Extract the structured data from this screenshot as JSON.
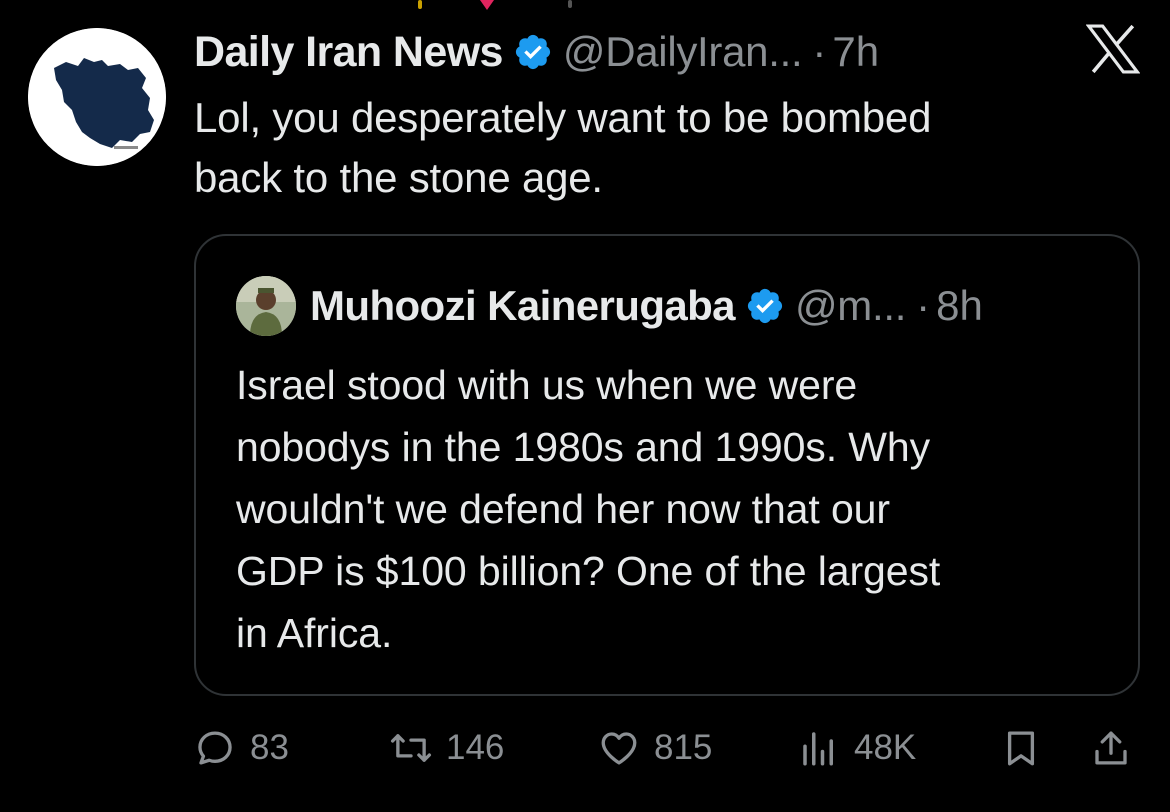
{
  "tweet": {
    "author_name": "Daily Iran News",
    "handle": "@DailyIran...",
    "separator": "·",
    "time": "7h",
    "text_line1": "Lol, you desperately want to be bombed",
    "text_line2": "back to the stone age."
  },
  "quoted_tweet": {
    "author_name": "Muhoozi Kainerugaba",
    "handle": "@m...",
    "separator": "·",
    "time": "8h",
    "lines": [
      "Israel stood with us when we were",
      "nobodys in the 1980s and 1990s. Why",
      "wouldn't we defend her now that our",
      "GDP is $100 billion? One of the largest",
      "in Africa."
    ]
  },
  "actions": {
    "replies": "83",
    "retweets": "146",
    "likes": "815",
    "views": "48K"
  },
  "icons": {
    "verified": "verified-badge-icon",
    "platform": "x-logo-icon",
    "reply": "reply-icon",
    "retweet": "retweet-icon",
    "like": "heart-icon",
    "views": "views-icon",
    "bookmark": "bookmark-icon",
    "share": "share-icon"
  },
  "colors": {
    "background": "#000000",
    "text": "#e7e9ea",
    "muted": "#8b8f93",
    "verified": "#1d9bf0",
    "border": "#2f3336"
  }
}
